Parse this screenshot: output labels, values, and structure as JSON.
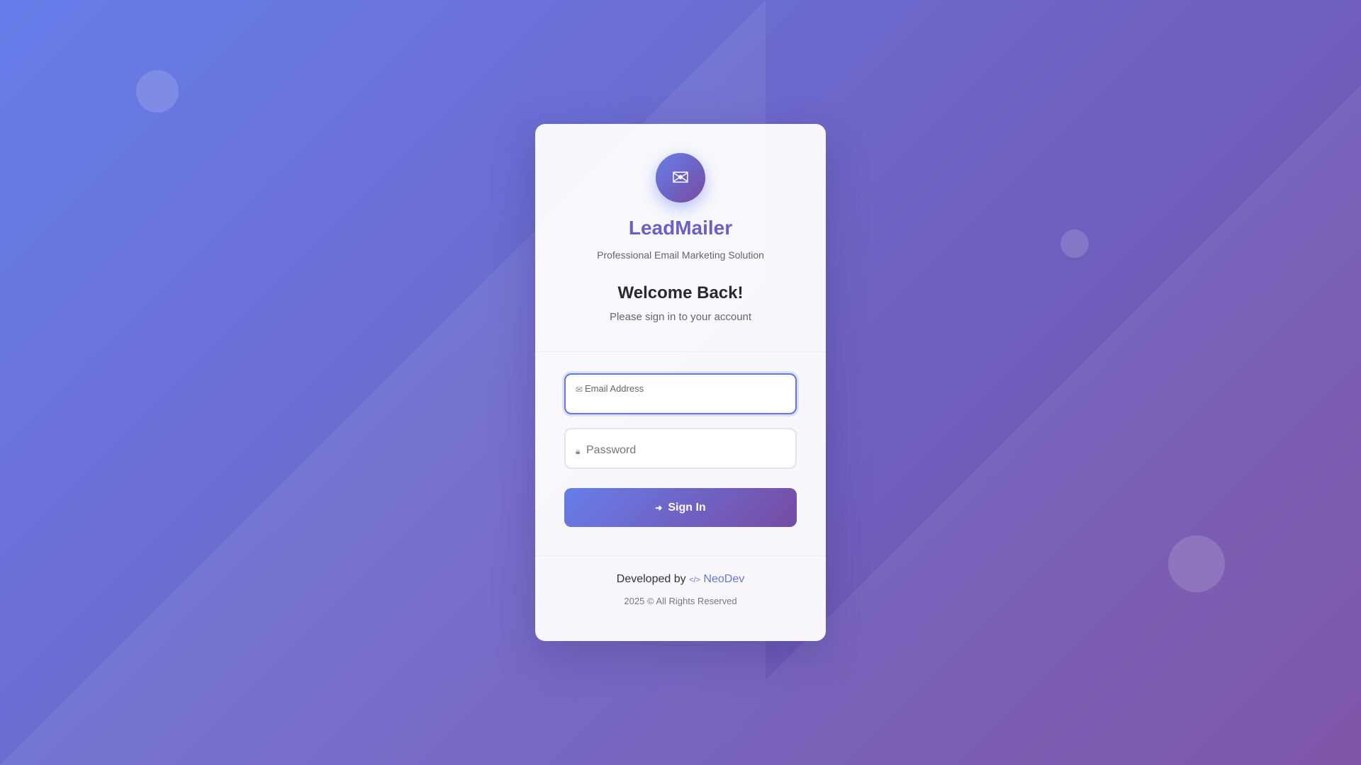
{
  "app": {
    "name": "LeadMailer",
    "tagline": "Professional Email Marketing Solution",
    "logo_icon": "mail-icon"
  },
  "login": {
    "heading": "Welcome Back!",
    "subheading": "Please sign in to your account",
    "email_label": "Email Address",
    "email_value": "",
    "email_icon": "envelope-icon",
    "password_label": "Password",
    "password_value": "",
    "password_icon": "lock-icon",
    "signin_label": "Sign In",
    "signin_icon": "sign-in-icon"
  },
  "footer": {
    "developed_by": "Developed by",
    "developer": "NeoDev",
    "developer_icon": "code-icon",
    "copyright": "2025 © All Rights Reserved"
  },
  "colors": {
    "gradient_start": "#667eea",
    "gradient_end": "#764ba2",
    "brand_text": "#6a5fc9",
    "focus_border": "#6675e8"
  }
}
